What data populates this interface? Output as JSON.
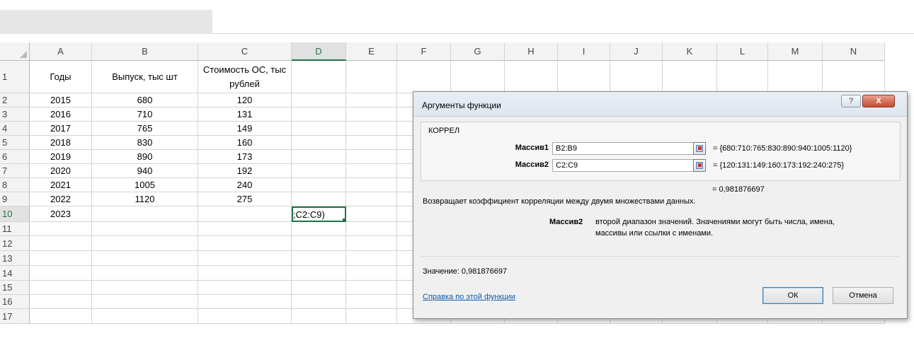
{
  "columns": [
    "A",
    "B",
    "C",
    "D",
    "E",
    "F",
    "G",
    "H",
    "I",
    "J",
    "K",
    "L",
    "M",
    "N",
    "C"
  ],
  "rows": [
    "1",
    "2",
    "3",
    "4",
    "5",
    "6",
    "7",
    "8",
    "9",
    "10",
    "11",
    "12",
    "13",
    "14",
    "15",
    "16",
    "17"
  ],
  "table": {
    "headers": {
      "a": "Годы",
      "b": "Выпуск, тыс шт",
      "c": "Стоимость ОС, тыс рублей"
    },
    "data": [
      {
        "year": "2015",
        "output": "680",
        "cost": "120"
      },
      {
        "year": "2016",
        "output": "710",
        "cost": "131"
      },
      {
        "year": "2017",
        "output": "765",
        "cost": "149"
      },
      {
        "year": "2018",
        "output": "830",
        "cost": "160"
      },
      {
        "year": "2019",
        "output": "890",
        "cost": "173"
      },
      {
        "year": "2020",
        "output": "940",
        "cost": "192"
      },
      {
        "year": "2021",
        "output": "1005",
        "cost": "240"
      },
      {
        "year": "2022",
        "output": "1120",
        "cost": "275"
      }
    ],
    "row10_year": "2023",
    "active_cell_text": ";C2:C9)"
  },
  "dialog": {
    "title": "Аргументы функции",
    "help_glyph": "?",
    "close_glyph": "X",
    "function_name": "КОРРЕЛ",
    "arg1": {
      "label": "Массив1",
      "value": "B2:B9",
      "result": "=  {680:710:765:830:890:940:1005:1120}"
    },
    "arg2": {
      "label": "Массив2",
      "value": "C2:C9",
      "result": "=  {120:131:149:160:173:192:240:275}"
    },
    "formula_result": "=  0,981876697",
    "description": "Возвращает коэффициент корреляции между двумя множествами данных.",
    "arg_help_label": "Массив2",
    "arg_help_line1": "второй диапазон значений. Значениями могут быть числа, имена,",
    "arg_help_line2": "массивы или ссылки с именами.",
    "value_label": "Значение:  0,981876697",
    "help_link": "Справка по этой функции",
    "ok": "ОК",
    "cancel": "Отмена"
  }
}
